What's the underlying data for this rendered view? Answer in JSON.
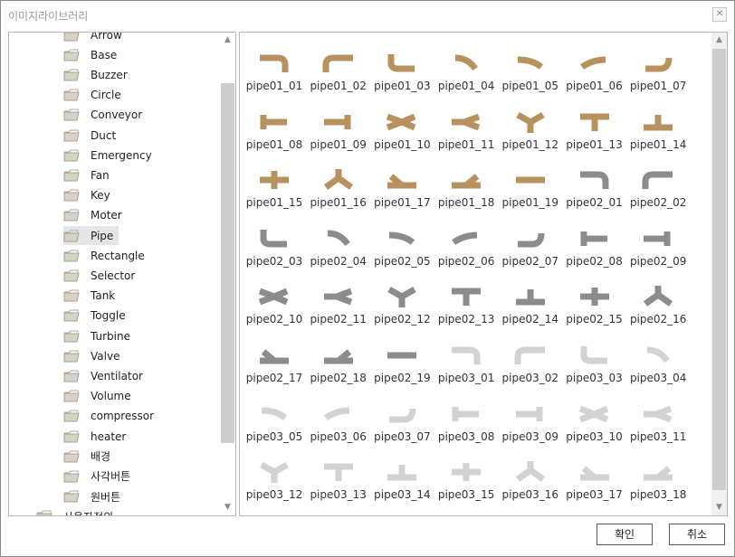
{
  "window": {
    "title": "이미지라이브러리",
    "close_label": "✕"
  },
  "tree": {
    "items": [
      {
        "label": "Arrow"
      },
      {
        "label": "Base"
      },
      {
        "label": "Buzzer"
      },
      {
        "label": "Circle"
      },
      {
        "label": "Conveyor"
      },
      {
        "label": "Duct"
      },
      {
        "label": "Emergency"
      },
      {
        "label": "Fan"
      },
      {
        "label": "Key"
      },
      {
        "label": "Moter"
      },
      {
        "label": "Pipe",
        "selected": true
      },
      {
        "label": "Rectangle"
      },
      {
        "label": "Selector"
      },
      {
        "label": "Tank"
      },
      {
        "label": "Toggle"
      },
      {
        "label": "Turbine"
      },
      {
        "label": "Valve"
      },
      {
        "label": "Ventilator"
      },
      {
        "label": "Volume"
      },
      {
        "label": "compressor"
      },
      {
        "label": "heater"
      },
      {
        "label": "배경"
      },
      {
        "label": "사각버튼"
      },
      {
        "label": "원버튼"
      },
      {
        "label": "사용자정의"
      }
    ]
  },
  "gallery": {
    "items": [
      "pipe01_01",
      "pipe01_02",
      "pipe01_03",
      "pipe01_04",
      "pipe01_05",
      "pipe01_06",
      "pipe01_07",
      "pipe01_08",
      "pipe01_09",
      "pipe01_10",
      "pipe01_11",
      "pipe01_12",
      "pipe01_13",
      "pipe01_14",
      "pipe01_15",
      "pipe01_16",
      "pipe01_17",
      "pipe01_18",
      "pipe01_19",
      "pipe02_01",
      "pipe02_02",
      "pipe02_03",
      "pipe02_04",
      "pipe02_05",
      "pipe02_06",
      "pipe02_07",
      "pipe02_08",
      "pipe02_09",
      "pipe02_10",
      "pipe02_11",
      "pipe02_12",
      "pipe02_13",
      "pipe02_14",
      "pipe02_15",
      "pipe02_16",
      "pipe02_17",
      "pipe02_18",
      "pipe02_19",
      "pipe03_01",
      "pipe03_02",
      "pipe03_03",
      "pipe03_04",
      "pipe03_05",
      "pipe03_06",
      "pipe03_07",
      "pipe03_08",
      "pipe03_09",
      "pipe03_10",
      "pipe03_11",
      "pipe03_12",
      "pipe03_13",
      "pipe03_14",
      "pipe03_15",
      "pipe03_16",
      "pipe03_17",
      "pipe03_18"
    ],
    "style_colors": {
      "pipe01": "#b8925e",
      "pipe02": "#8c8c8c",
      "pipe03": "#d2d2d2"
    }
  },
  "buttons": {
    "ok_label": "확인",
    "cancel_label": "취소"
  }
}
